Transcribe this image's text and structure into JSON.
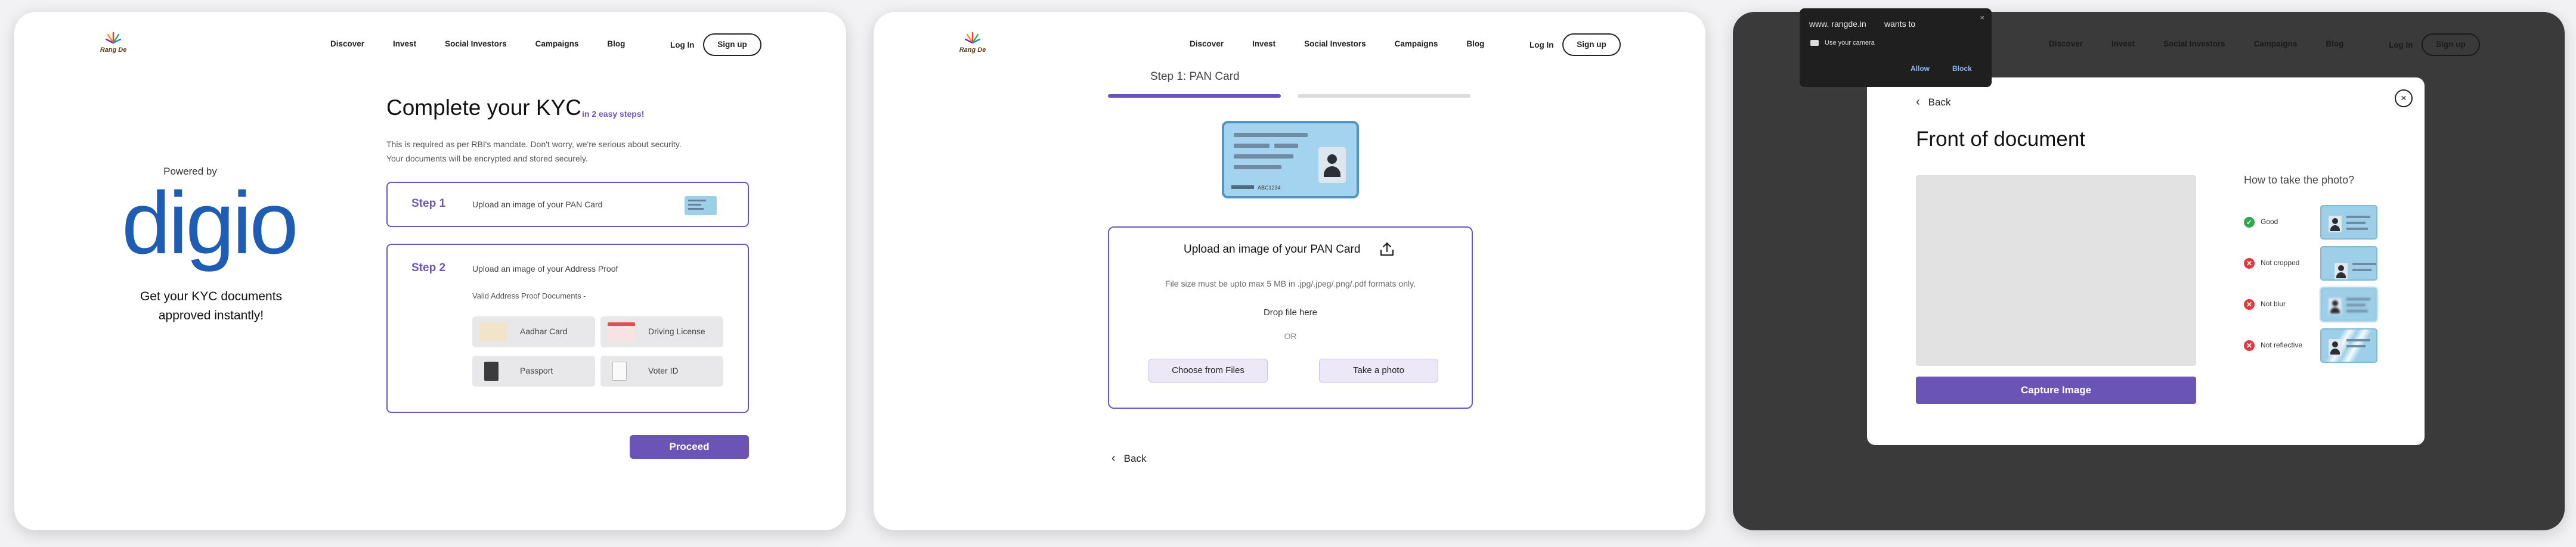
{
  "nav": {
    "logo_text": "Rang De",
    "links": [
      "Discover",
      "Invest",
      "Social Investors",
      "Campaigns",
      "Blog"
    ],
    "login": "Log In",
    "signup": "Sign up"
  },
  "kyc": {
    "powered_by": "Powered by",
    "brand": "digio",
    "tagline": "Get your KYC documents approved instantly!",
    "title": "Complete your KYC",
    "subtitle": "in 2 easy steps!",
    "note_line1": "This is required as per RBI's mandate. Don't worry, we're serious about security.",
    "note_line2": "Your documents will be encrypted and stored securely.",
    "step1_label": "Step 1",
    "step1_text": "Upload an image of your PAN Card",
    "step2_label": "Step 2",
    "step2_text": "Upload an image of your Address Proof",
    "proof_note": "Valid Address Proof Documents -",
    "docs": [
      "Aadhar Card",
      "Driving License",
      "Passport",
      "Voter ID"
    ],
    "proceed": "Proceed"
  },
  "pan": {
    "tab_title": "Step 1: PAN Card",
    "card_number": "ABC1234",
    "upload_title": "Upload an image of your PAN Card",
    "file_note": "File size must be upto max 5 MB in .jpg/.jpeg/.png/.pdf formats only.",
    "drop": "Drop file here",
    "or": "OR",
    "choose": "Choose from Files",
    "photo": "Take a photo",
    "back": "Back"
  },
  "camera": {
    "back": "Back",
    "close": "×",
    "title": "Front of document",
    "capture": "Capture Image",
    "how": "How to take the photo?",
    "tips": [
      {
        "label": "Good",
        "status": "ok"
      },
      {
        "label": "Not cropped",
        "status": "bad"
      },
      {
        "label": "Not blur",
        "status": "bad"
      },
      {
        "label": "Not reflective",
        "status": "bad"
      }
    ]
  },
  "permission": {
    "site": "www. rangde.in",
    "wants": "wants to",
    "use_camera": "Use your camera",
    "allow": "Allow",
    "block": "Block",
    "close": "×"
  },
  "colors": {
    "accent": "#6a55b6",
    "digio_blue": "#1f5db5",
    "ok": "#2fa84f",
    "bad": "#e0393e"
  }
}
